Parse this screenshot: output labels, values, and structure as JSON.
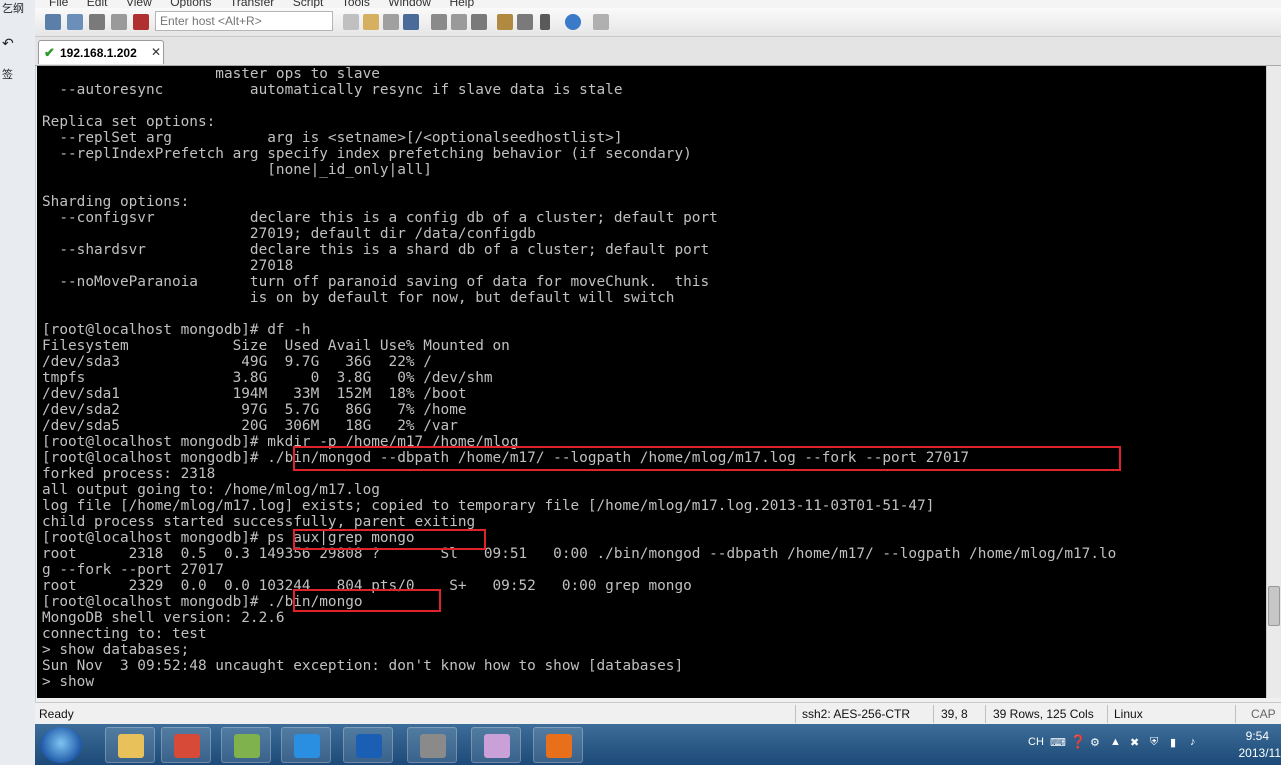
{
  "left_strip": {
    "label1": "乞纲",
    "label2": "签"
  },
  "menubar": {
    "items": [
      "File",
      "Edit",
      "View",
      "Options",
      "Transfer",
      "Script",
      "Tools",
      "Window",
      "Help"
    ]
  },
  "toolbar": {
    "host_placeholder": "Enter host <Alt+R>"
  },
  "tab": {
    "title": "192.168.1.202",
    "close": "✕"
  },
  "terminal": {
    "lines": [
      "                    master ops to slave",
      "  --autoresync          automatically resync if slave data is stale",
      "",
      "Replica set options:",
      "  --replSet arg           arg is <setname>[/<optionalseedhostlist>]",
      "  --replIndexPrefetch arg specify index prefetching behavior (if secondary)",
      "                          [none|_id_only|all]",
      "",
      "Sharding options:",
      "  --configsvr           declare this is a config db of a cluster; default port",
      "                        27019; default dir /data/configdb",
      "  --shardsvr            declare this is a shard db of a cluster; default port",
      "                        27018",
      "  --noMoveParanoia      turn off paranoid saving of data for moveChunk.  this",
      "                        is on by default for now, but default will switch",
      "",
      "[root@localhost mongodb]# df -h",
      "Filesystem            Size  Used Avail Use% Mounted on",
      "/dev/sda3              49G  9.7G   36G  22% /",
      "tmpfs                 3.8G     0  3.8G   0% /dev/shm",
      "/dev/sda1             194M   33M  152M  18% /boot",
      "/dev/sda2              97G  5.7G   86G   7% /home",
      "/dev/sda5              20G  306M   18G   2% /var",
      "[root@localhost mongodb]# mkdir -p /home/m17 /home/mlog",
      "[root@localhost mongodb]# ./bin/mongod --dbpath /home/m17/ --logpath /home/mlog/m17.log --fork --port 27017",
      "forked process: 2318",
      "all output going to: /home/mlog/m17.log",
      "log file [/home/mlog/m17.log] exists; copied to temporary file [/home/mlog/m17.log.2013-11-03T01-51-47]",
      "child process started successfully, parent exiting",
      "[root@localhost mongodb]# ps aux|grep mongo",
      "root      2318  0.5  0.3 149356 29808 ?       Sl   09:51   0:00 ./bin/mongod --dbpath /home/m17/ --logpath /home/mlog/m17.lo",
      "g --fork --port 27017",
      "root      2329  0.0  0.0 103244   804 pts/0    S+   09:52   0:00 grep mongo",
      "[root@localhost mongodb]# ./bin/mongo",
      "MongoDB shell version: 2.2.6",
      "connecting to: test",
      "> show databases;",
      "Sun Nov  3 09:52:48 uncaught exception: don't know how to show [databases]",
      "> show"
    ],
    "highlight_color": "#e0222a"
  },
  "statusbar": {
    "ready": "Ready",
    "encryption": "ssh2: AES-256-CTR",
    "cursor": "39,  8",
    "size": "39 Rows, 125 Cols",
    "os": "Linux",
    "caps": "CAP"
  },
  "taskbar": {
    "apps": [
      {
        "icon": "file-explorer-icon",
        "color": "#e8c15a"
      },
      {
        "icon": "chrome-icon",
        "color": "#d84a38"
      },
      {
        "icon": "app-shield-icon",
        "color": "#7fb24c"
      },
      {
        "icon": "qq-icon",
        "color": "#2a8fe0"
      },
      {
        "icon": "wps-writer-icon",
        "color": "#1a5fb4"
      },
      {
        "icon": "securecrt-icon",
        "color": "#8a8a8a"
      },
      {
        "icon": "paint-icon",
        "color": "#c9a0d8"
      },
      {
        "icon": "presentation-icon",
        "color": "#e8701a"
      }
    ],
    "tray_lang": "CH",
    "time": "9:54",
    "date": "2013/11"
  }
}
